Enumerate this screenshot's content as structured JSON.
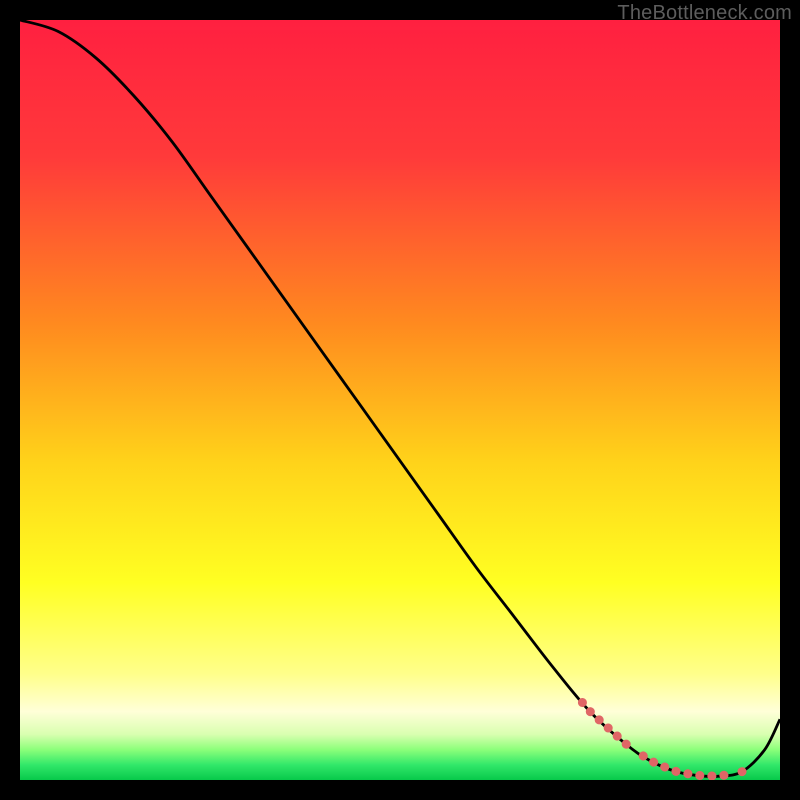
{
  "watermark": "TheBottleneck.com",
  "chart_data": {
    "type": "line",
    "title": "",
    "xlabel": "",
    "ylabel": "",
    "xlim": [
      0,
      100
    ],
    "ylim": [
      0,
      100
    ],
    "background_gradient": {
      "stops": [
        {
          "pct": 0,
          "color": "#ff2040"
        },
        {
          "pct": 18,
          "color": "#ff3a3a"
        },
        {
          "pct": 40,
          "color": "#ff8a1f"
        },
        {
          "pct": 58,
          "color": "#ffd21a"
        },
        {
          "pct": 74,
          "color": "#ffff22"
        },
        {
          "pct": 86,
          "color": "#ffff8a"
        },
        {
          "pct": 91,
          "color": "#ffffd8"
        },
        {
          "pct": 94,
          "color": "#d9ffb0"
        },
        {
          "pct": 96,
          "color": "#8cff7a"
        },
        {
          "pct": 98,
          "color": "#32e86a"
        },
        {
          "pct": 100,
          "color": "#07c94a"
        }
      ]
    },
    "curve": {
      "x": [
        0,
        5,
        10,
        15,
        20,
        25,
        30,
        35,
        40,
        45,
        50,
        55,
        60,
        65,
        70,
        75,
        80,
        83,
        86,
        89,
        92,
        95,
        98,
        100
      ],
      "y": [
        100,
        98.5,
        95,
        90,
        84,
        77,
        70,
        63,
        56,
        49,
        42,
        35,
        28,
        21.5,
        15,
        9,
        4.5,
        2.5,
        1.2,
        0.6,
        0.5,
        1.1,
        4,
        8
      ]
    },
    "highlight_segments": [
      {
        "x_from": 74,
        "x_to": 80,
        "y_approx_from": 10,
        "y_approx_to": 4.5
      },
      {
        "x_from": 82,
        "x_to": 94,
        "y_approx_from": 2.0,
        "y_approx_to": 0.6
      },
      {
        "x_from": 95,
        "x_to": 96,
        "y_approx_from": 1.3,
        "y_approx_to": 2.0
      }
    ],
    "colors": {
      "curve": "#000000",
      "highlight": "#e06666"
    }
  }
}
